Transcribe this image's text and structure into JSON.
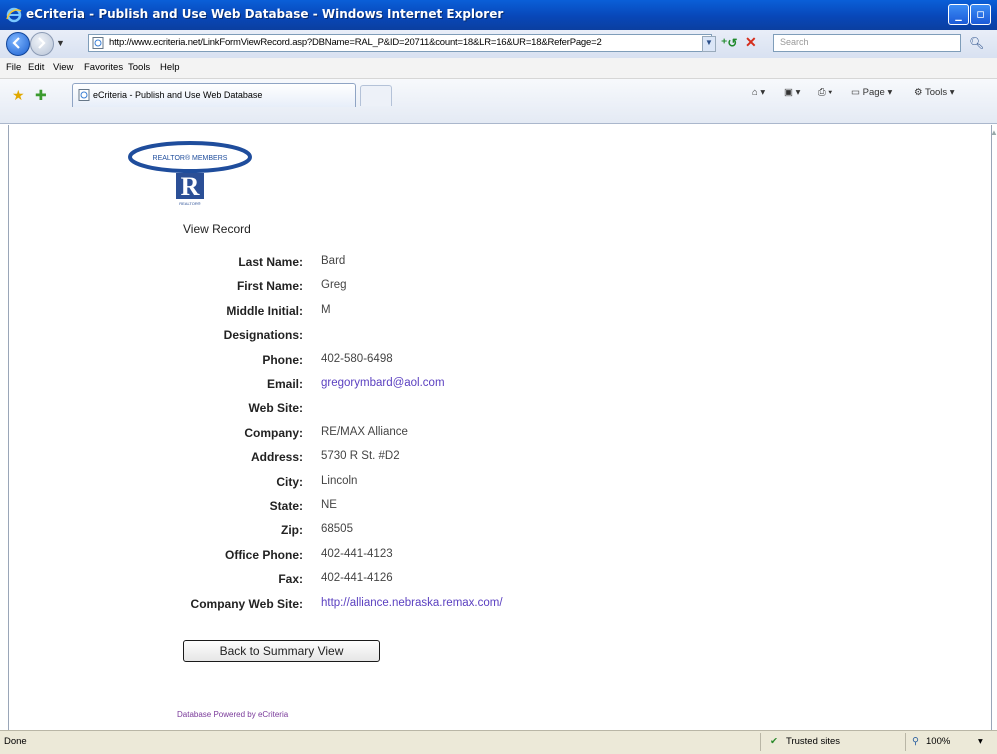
{
  "window": {
    "title": "eCriteria - Publish and Use Web Database - Windows Internet Explorer"
  },
  "address": {
    "url": "http://www.ecriteria.net/LinkFormViewRecord.asp?DBName=RAL_P&ID=20711&count=18&LR=16&UR=18&ReferPage=2",
    "search_placeholder": "Search"
  },
  "menu": [
    "File",
    "Edit",
    "View",
    "Favorites",
    "Tools",
    "Help"
  ],
  "tab": {
    "label": "eCriteria - Publish and Use Web Database"
  },
  "toolbar": {
    "page_label": "Page",
    "tools_label": "Tools"
  },
  "logo": {
    "text": "REALTOR® MEMBERS",
    "mark": "R",
    "subtext": "REALTOR®"
  },
  "page": {
    "heading": "View Record",
    "fields": [
      {
        "label": "Last Name:",
        "value": "Bard"
      },
      {
        "label": "First Name:",
        "value": "Greg"
      },
      {
        "label": "Middle Initial:",
        "value": "M"
      },
      {
        "label": "Designations:",
        "value": ""
      },
      {
        "label": "Phone:",
        "value": "402-580-6498"
      },
      {
        "label": "Email:",
        "value": "gregorymbard@aol.com"
      },
      {
        "label": "Web Site:",
        "value": ""
      },
      {
        "label": "Company:",
        "value": "RE/MAX Alliance"
      },
      {
        "label": "Address:",
        "value": "5730 R St. #D2"
      },
      {
        "label": "City:",
        "value": "Lincoln"
      },
      {
        "label": "State:",
        "value": "NE"
      },
      {
        "label": "Zip:",
        "value": "68505"
      },
      {
        "label": "Office Phone:",
        "value": "402-441-4123"
      },
      {
        "label": "Fax:",
        "value": "402-441-4126"
      },
      {
        "label": "Company Web Site:",
        "value": "http://alliance.nebraska.remax.com/"
      }
    ],
    "back_button": "Back to Summary View",
    "powered_by": "Database Powered by eCriteria"
  },
  "status": {
    "left": "Done",
    "zone": "Trusted sites",
    "zoom": "100%"
  }
}
